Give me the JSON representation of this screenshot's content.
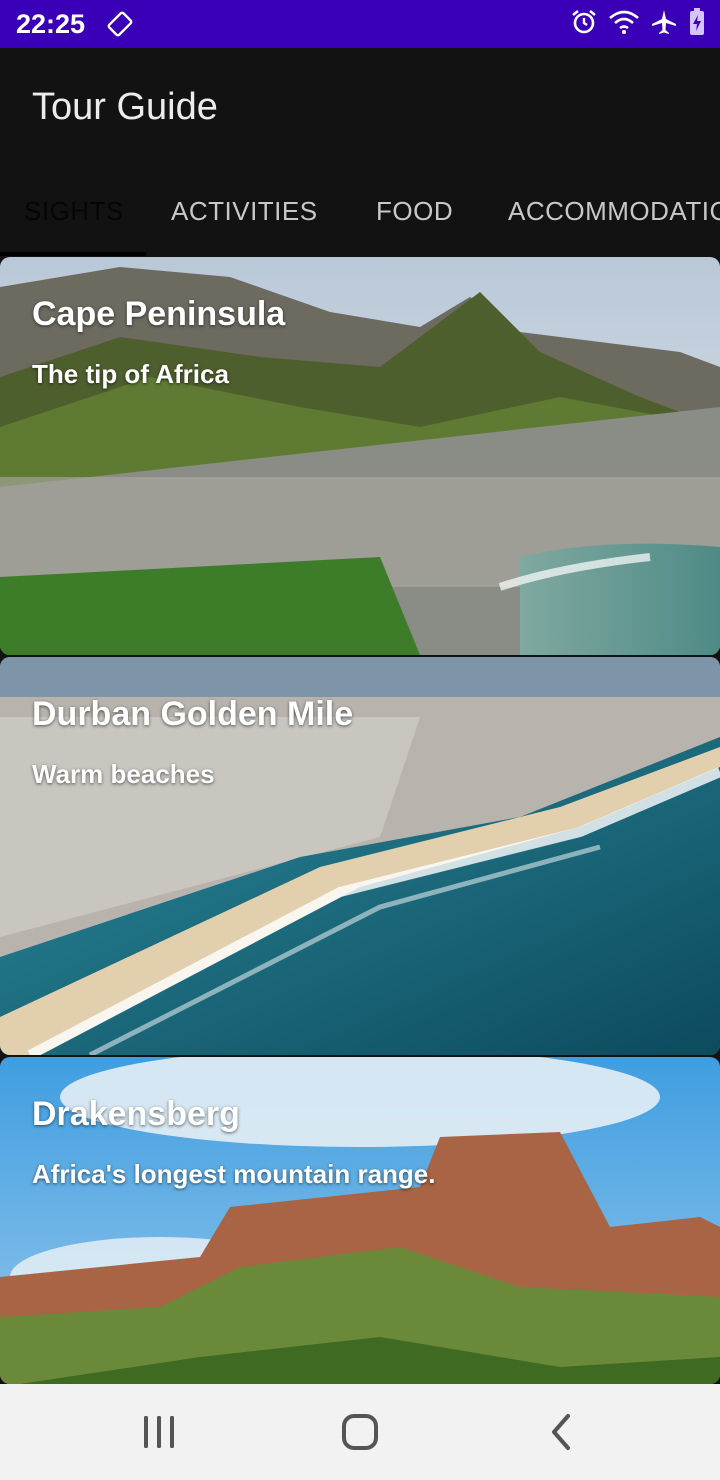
{
  "status_bar": {
    "time": "22:25",
    "icons": [
      "screen-rotate-icon",
      "alarm-icon",
      "wifi-icon",
      "airplane-mode-icon",
      "battery-charging-icon"
    ]
  },
  "app_bar": {
    "title": "Tour Guide"
  },
  "tabs": [
    {
      "label": "SIGHTS",
      "active": true
    },
    {
      "label": "ACTIVITIES",
      "active": false
    },
    {
      "label": "FOOD",
      "active": false
    },
    {
      "label": "ACCOMMODATIC",
      "active": false
    }
  ],
  "cards": [
    {
      "title": "Cape Peninsula",
      "subtitle": "The tip of Africa",
      "image": "cape-peninsula-photo"
    },
    {
      "title": "Durban Golden Mile",
      "subtitle": "Warm beaches",
      "image": "durban-beach-photo"
    },
    {
      "title": "Drakensberg",
      "subtitle": "Africa's longest mountain range.",
      "image": "drakensberg-mountains-photo"
    }
  ],
  "nav_bar": {
    "buttons": [
      "recent-apps-icon",
      "home-icon",
      "back-icon"
    ]
  },
  "colors": {
    "status_bar": "#3a00b8",
    "app_bar": "#121212",
    "nav_bar": "#f2f2f2"
  }
}
